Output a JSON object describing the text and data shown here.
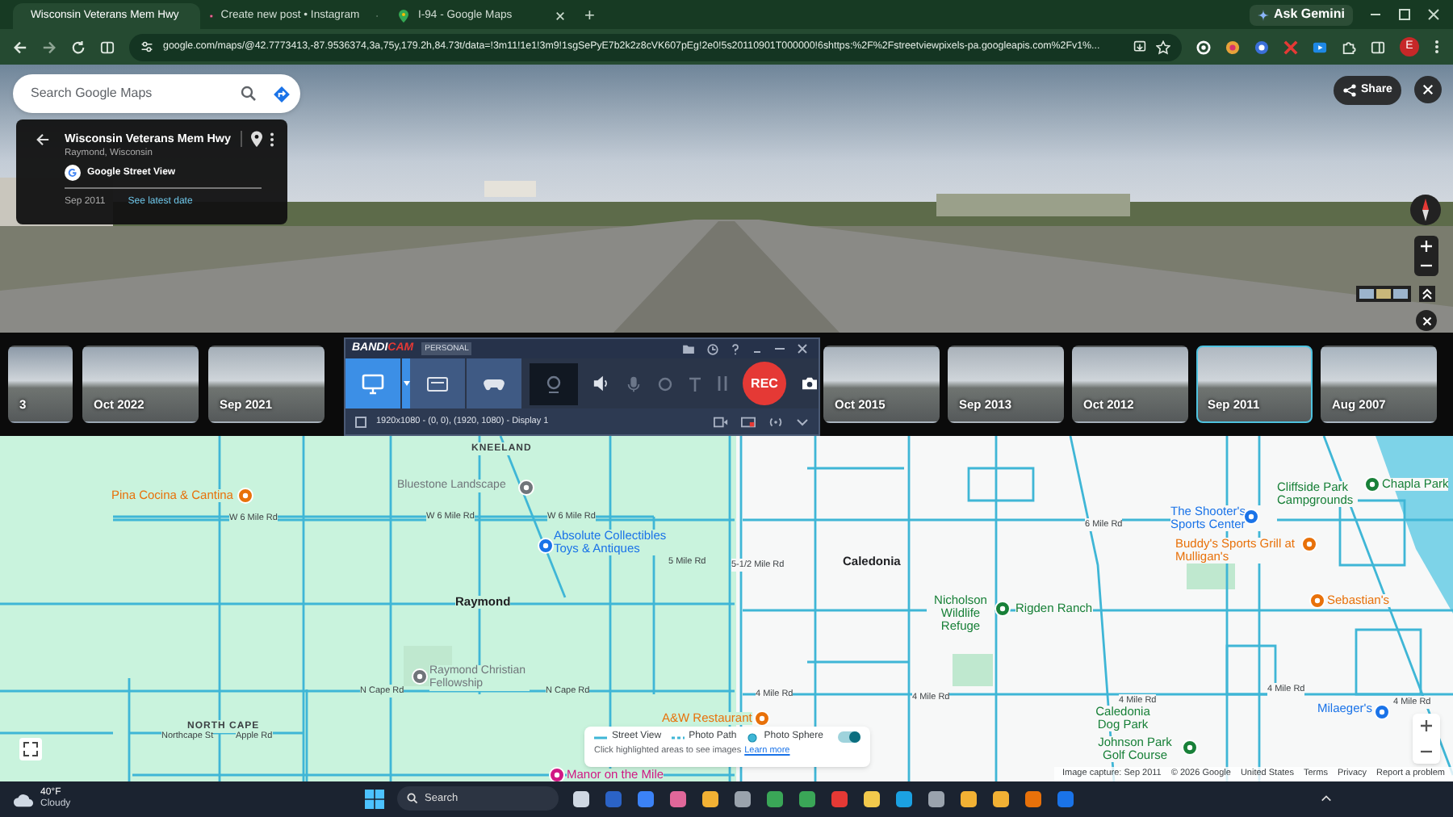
{
  "browser": {
    "tabs": [
      {
        "title": "Wisconsin Veterans Mem Hwy",
        "selected": true,
        "kind": "maps"
      },
      {
        "title": "Create new post • Instagram",
        "selected": false,
        "kind": "instagram"
      },
      {
        "title": "I-94 - Google Maps",
        "selected": false,
        "kind": "maps"
      }
    ],
    "new_tab": "+",
    "gemini_button": "Ask Gemini",
    "url": "google.com/maps/@42.7773413,-87.9536374,3a,75y,179.2h,84.73t/data=!3m11!1e1!3m9!1sgSePyE7b2k2z8cVK607pEg!2e0!5s20110901T000000!6shttps:%2F%2Fstreetviewpixels-pa.googleapis.com%2Fv1%...",
    "profile_initial": "E"
  },
  "street_view": {
    "search": {
      "placeholder": "Search Google Maps"
    },
    "location_card": {
      "title": "Wisconsin Veterans Mem Hwy",
      "subtitle": "Raymond, Wisconsin",
      "source": "Google Street View",
      "date": "Sep 2011",
      "latest_link": "See latest date"
    },
    "share_button": "Share"
  },
  "timeline": {
    "thumbnails": [
      {
        "date": "3",
        "selected": false
      },
      {
        "date": "Oct 2022",
        "selected": false
      },
      {
        "date": "Sep 2021",
        "selected": false
      },
      {
        "date": "Oct 2015",
        "selected": false
      },
      {
        "date": "Sep 2013",
        "selected": false
      },
      {
        "date": "Oct 2012",
        "selected": false
      },
      {
        "date": "Sep 2011",
        "selected": true
      },
      {
        "date": "Aug 2007",
        "selected": false
      }
    ]
  },
  "recorder": {
    "brand": "BANDI",
    "brand_accent": "CAM",
    "edition": "PERSONAL",
    "modes": [
      {
        "kind": "screen",
        "selected": true
      },
      {
        "kind": "hdmi",
        "selected": false
      },
      {
        "kind": "game",
        "selected": false
      }
    ],
    "rec_button": "REC",
    "capture_area": "1920x1080 - (0, 0), (1920, 1080) - Display 1",
    "area_checked": false
  },
  "map": {
    "labels": [
      {
        "text": "KNEELAND",
        "kind": "area"
      },
      {
        "text": "Bluestone Landscape",
        "kind": "venue"
      },
      {
        "text": "Pina Cocina & Cantina",
        "kind": "food"
      },
      {
        "text": "W 6 Mile Rd",
        "kind": "road"
      },
      {
        "text": "W 6 Mile Rd",
        "kind": "road"
      },
      {
        "text": "W 6 Mile Rd",
        "kind": "road"
      },
      {
        "text": "Absolute Collectibles Toys & Antiques",
        "kind": "shop"
      },
      {
        "text": "5 Mile Rd",
        "kind": "road"
      },
      {
        "text": "Raymond",
        "kind": "town"
      },
      {
        "text": "Raymond Christian Fellowship",
        "kind": "venue"
      },
      {
        "text": "N Cape Rd",
        "kind": "road"
      },
      {
        "text": "N Cape Rd",
        "kind": "road"
      },
      {
        "text": "NORTH CAPE",
        "kind": "area"
      },
      {
        "text": "Northcape St",
        "kind": "road"
      },
      {
        "text": "Apple Rd",
        "kind": "road"
      },
      {
        "text": "A&W Restaurant",
        "kind": "food"
      },
      {
        "text": "Manor on the Mile",
        "kind": "lodging"
      },
      {
        "text": "5-1/2 Mile Rd",
        "kind": "road"
      },
      {
        "text": "Caledonia",
        "kind": "town"
      },
      {
        "text": "6 Mile Rd",
        "kind": "road"
      },
      {
        "text": "Nicholson Wildlife Refuge",
        "kind": "park"
      },
      {
        "text": "Rigden Ranch",
        "kind": "park"
      },
      {
        "text": "The Shooter's Sports Center",
        "kind": "shop"
      },
      {
        "text": "Buddy's Sports Grill at Mulligan's",
        "kind": "food"
      },
      {
        "text": "Cliffside Park Campgrounds",
        "kind": "park"
      },
      {
        "text": "Chapla Park",
        "kind": "park"
      },
      {
        "text": "Sebastian's",
        "kind": "food"
      },
      {
        "text": "4 Mile Rd",
        "kind": "road"
      },
      {
        "text": "4 Mile Rd",
        "kind": "road"
      },
      {
        "text": "4 Mile Rd",
        "kind": "road"
      },
      {
        "text": "4 Mile Rd",
        "kind": "road"
      },
      {
        "text": "Milaeger's",
        "kind": "shop"
      },
      {
        "text": "4 Mile Rd",
        "kind": "road"
      },
      {
        "text": "Caledonia Dog Park",
        "kind": "park"
      },
      {
        "text": "Johnson Park Golf Course",
        "kind": "park"
      }
    ],
    "legend": {
      "items": [
        {
          "label": "Street View",
          "kind": "line"
        },
        {
          "label": "Photo Path",
          "kind": "dashed"
        },
        {
          "label": "Photo Sphere",
          "kind": "dot"
        }
      ],
      "hint": "Click highlighted areas to see images",
      "link": "Learn more",
      "toggle_on": true
    },
    "footer": [
      "Image capture: Sep 2011",
      "© 2026 Google",
      "United States",
      "Terms",
      "Privacy",
      "Report a problem"
    ]
  },
  "taskbar": {
    "weather": {
      "temperature": "40°F",
      "condition": "Cloudy"
    },
    "search": {
      "placeholder": "Search"
    }
  }
}
